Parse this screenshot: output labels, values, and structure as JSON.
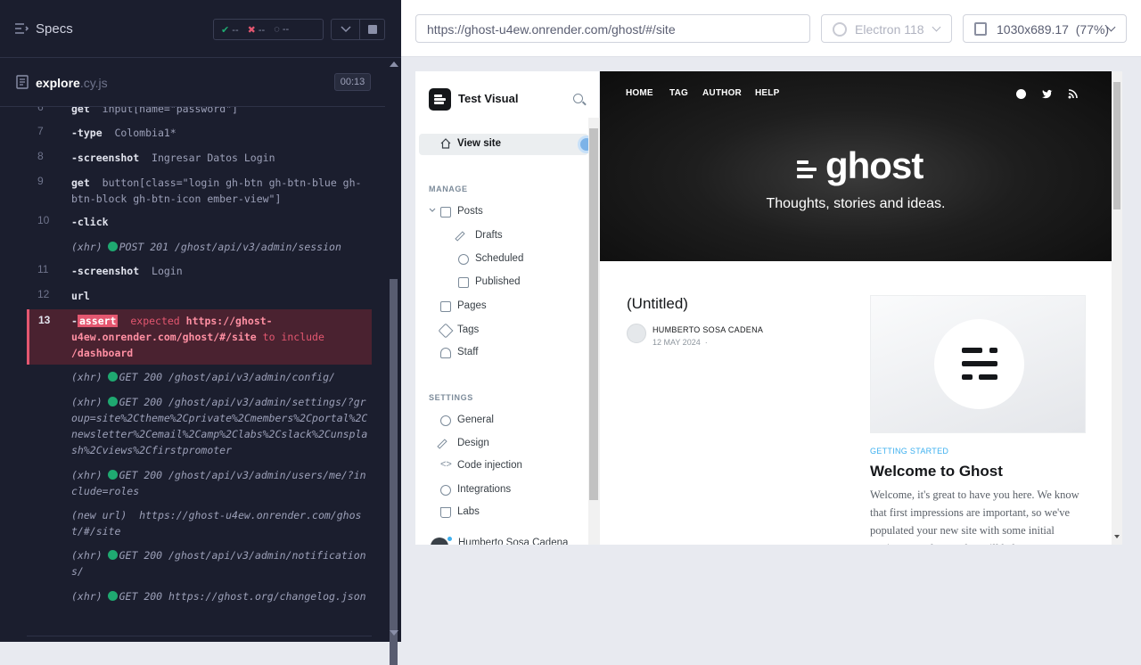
{
  "reporter": {
    "specs_label": "Specs",
    "stats": {
      "passed": "--",
      "failed": "--",
      "pending": "--"
    },
    "file": {
      "name": "explore",
      "ext": ".cy.js",
      "duration": "00:13"
    }
  },
  "log": {
    "lines": [
      {
        "num": "",
        "text": "get input[name=\"password\"]",
        "cmd": "get",
        "arg": "input[name=\"password\"]"
      },
      {
        "num": "7",
        "cmd": "-type",
        "arg": "Colombia1*"
      },
      {
        "num": "8",
        "cmd": "-screenshot",
        "arg": "Ingresar Datos Login"
      },
      {
        "num": "9",
        "cmd": "get",
        "arg": "button[class=\"login gh-btn gh-btn-blue gh-btn-block gh-btn-icon ember-view\"]"
      },
      {
        "num": "10",
        "cmd": "-click",
        "arg": ""
      },
      {
        "num": "",
        "xhr": "(xhr)",
        "req": "POST 201 /ghost/api/v3/admin/session"
      },
      {
        "num": "11",
        "cmd": "-screenshot",
        "arg": "Login"
      },
      {
        "num": "12",
        "cmd": "url",
        "arg": ""
      }
    ],
    "assert": {
      "num": "13",
      "badge": "assert",
      "expected": "expected",
      "actual": "https://ghost-u4ew.onrender.com/ghost/#/site",
      "to_include": "to include",
      "target": "/dashboard"
    },
    "requests": [
      {
        "xhr": "(xhr)",
        "req": "GET 200 /ghost/api/v3/admin/config/"
      },
      {
        "xhr": "(xhr)",
        "req": "GET 200 /ghost/api/v3/admin/settings/?group=site%2Ctheme%2Cprivate%2Cmembers%2Cportal%2Cnewsletter%2Cemail%2Camp%2Clabs%2Cslack%2Cunsplash%2Cviews%2Cfirstpromoter"
      },
      {
        "xhr": "(xhr)",
        "req": "GET 200 /ghost/api/v3/admin/users/me/?include=roles"
      },
      {
        "xhr": "(new url)",
        "req": "https://ghost-u4ew.onrender.com/ghost/#/site"
      },
      {
        "xhr": "(xhr)",
        "req": "GET 200 /ghost/api/v3/admin/notifications/"
      },
      {
        "xhr": "(xhr)",
        "req": "GET 200 https://ghost.org/changelog.json"
      }
    ]
  },
  "runner": {
    "url": "https://ghost-u4ew.onrender.com/ghost/#/site",
    "browser": "Electron 118",
    "viewport": "1030x689.17",
    "zoom": "(77%)"
  },
  "ghost_admin": {
    "site_title": "Test Visual",
    "view_site": "View site",
    "manage_label": "MANAGE",
    "posts": "Posts",
    "drafts": "Drafts",
    "scheduled": "Scheduled",
    "published": "Published",
    "pages": "Pages",
    "tags": "Tags",
    "staff": "Staff",
    "settings_label": "SETTINGS",
    "general": "General",
    "design": "Design",
    "code_injection": "Code injection",
    "integrations": "Integrations",
    "labs": "Labs",
    "user": "Humberto Sosa Cadena"
  },
  "site_preview": {
    "nav": [
      "HOME",
      "TAG",
      "AUTHOR",
      "HELP"
    ],
    "logo": "ghost",
    "description": "Thoughts, stories and ideas.",
    "post1": {
      "title": "(Untitled)",
      "author": "HUMBERTO SOSA CADENA",
      "date": "12 MAY 2024",
      "sep": "·"
    },
    "card": {
      "tag": "GETTING STARTED",
      "title": "Welcome to Ghost",
      "excerpt": "Welcome, it's great to have you here. We know that first impressions are important, so we've populated your new site with some initial getting started posts that will help"
    }
  }
}
